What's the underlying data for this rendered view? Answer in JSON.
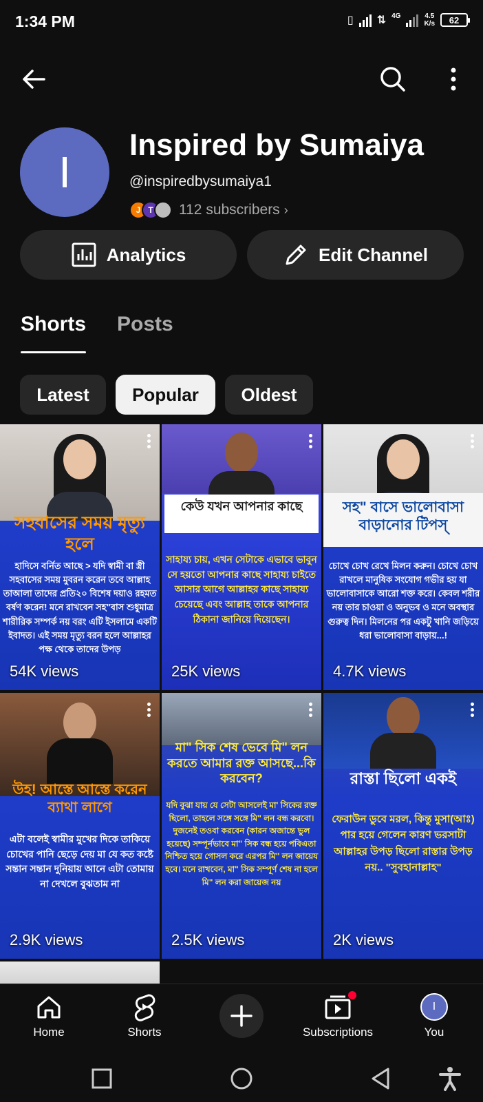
{
  "status_bar": {
    "time": "1:34 PM",
    "network": "4G",
    "speed_value": "4.5",
    "speed_unit": "K/s",
    "battery": "62"
  },
  "channel": {
    "avatar_letter": "I",
    "name": "Inspired by Sumaiya",
    "handle": "@inspiredbysumaiya1",
    "subscriber_avatars": [
      "J",
      "T"
    ],
    "subscribers": "112 subscribers",
    "avatar_color": "#5c6bc0"
  },
  "actions": {
    "analytics_label": "Analytics",
    "edit_label": "Edit Channel"
  },
  "tabs": [
    {
      "label": "Shorts",
      "active": true
    },
    {
      "label": "Posts",
      "active": false
    }
  ],
  "chips": [
    {
      "label": "Latest",
      "selected": false
    },
    {
      "label": "Popular",
      "selected": true
    },
    {
      "label": "Oldest",
      "selected": false
    }
  ],
  "shorts": [
    {
      "views": "54K views",
      "title": "সহবাসের সময় মৃত্যু হলে",
      "text": "হাদিসে বর্নিত আছে > যদি স্বামী বা স্ত্রী সহবাসের সময় মুবরন করেন তবে আল্লাহ তাআলা তাদের প্রতি২০ বিশেষ দয়াও রহমত বর্ষণ করেন! মনে রাখবেন সহ\"বাস শুধুমাত্র শারীরিক সম্পর্ক নয় বরং এটি ইসলামে একটি ইবাদত। এই সময় মৃত্যু বরন হলে আল্লাহর পক্ষ থেকে তাদের উপড়"
    },
    {
      "views": "25K views",
      "title": "কেউ যখন আপনার কাছে",
      "text": "সাহায্য চায়, এখন সেটাকে এভাবে ভাবুন সে হয়তো আপনার কাছে সাহায্য চাইতে আসার আগে আল্লাহর কাছে সাহায্য চেয়েছে এবং আল্লাহ তাকে আপনার ঠিকানা জানিয়ে দিয়েছেন।"
    },
    {
      "views": "4.7K views",
      "title": "সহ\" বাসে ভালোবাসা বাড়ানোর টিপস্",
      "text": "চোখে চোখ রেখে মিলন করুন। চোখে চোখ রাখলে মানুষিক সংযোগ গভীর হয় যা ভালোবাসাকে আরো শক্ত করে। কেবল শরীর নয় তার চাওয়া ও অনুভব ও মনে অবস্থার গুরুত্ব দিন। মিলনের পর একটু খানি জড়িয়ে ধরা ভালোবাসা বাড়ায়...!"
    },
    {
      "views": "2.9K views",
      "title": "উহ! আস্তে আস্তে করেন ব্যাথা লাগে",
      "text": "এটা বলেই স্বামীর মুখের দিকে তাকিয়ে চোখের পানি ছেড়ে দেয় মা যে কত কষ্টে সন্তান সন্তান দুনিয়ায় আনে এটা তোমায় না দেখলে বুঝতাম না"
    },
    {
      "views": "2.5K views",
      "title": "মা\" সিক শেষ ভেবে মি\" লন করতে আমার রক্ত আসছে...কি করবেন?",
      "text": "যদি বুঝা যায় যে সেটা আসলেই মা' সিকের রক্ত ছিলো, তাহলে সঙ্গে সঙ্গে মি\" লন বন্ধ করবো। দুজনেই তওবা করবেন (কারন অজান্তে ভুল হয়েছে) সম্পূর্নভাবে মা\" সিক বন্ধ হয়ে পবিএতা নিশ্চিত হয়ে গোসল করে এরপর মি\" লন জায়েয হবে। মনে রাখবেন, মা\" সিক সম্পূর্ণ শেষ না হলে মি\" লন করা জায়েজ নয়"
    },
    {
      "views": "2K views",
      "title": "রাস্তা ছিলো একই",
      "text": "ফেরাউন ডুবে মরল, কিন্তু মুসা(আঃ) পার হয়ে গেলেন কারণ ভরসাটা আল্লাহর উপড় ছিলো রাস্তার উপড় নয়.. \"সুবহানাল্লাহ\""
    }
  ],
  "bottom_nav": {
    "home": "Home",
    "shorts": "Shorts",
    "subscriptions": "Subscriptions",
    "you": "You",
    "you_avatar_letter": "I"
  }
}
